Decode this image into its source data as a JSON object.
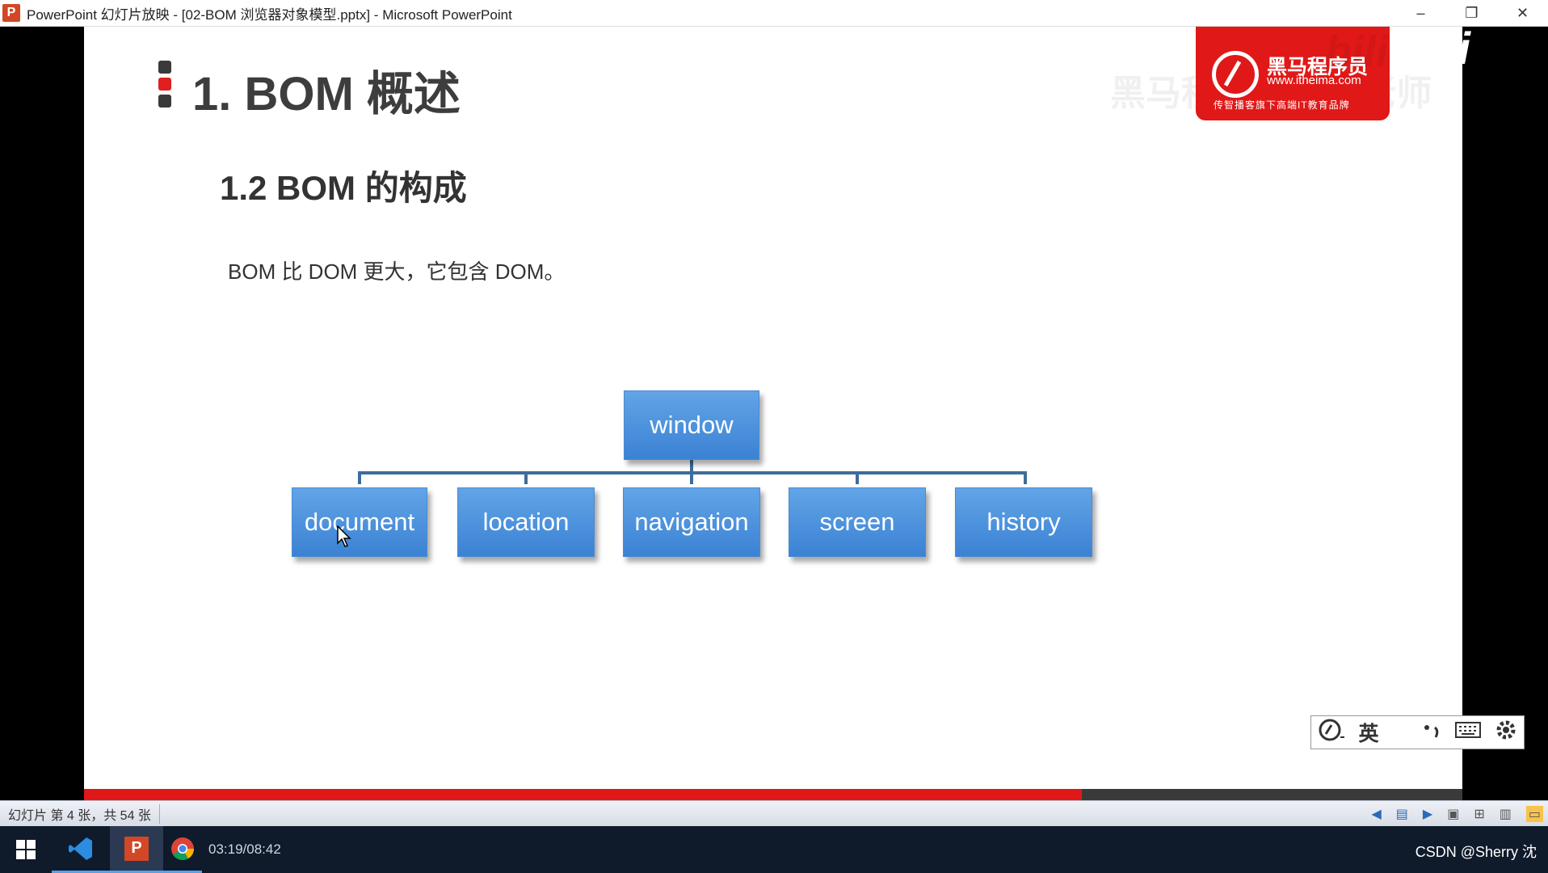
{
  "window": {
    "app_icon": "P",
    "title": "PowerPoint 幻灯片放映 - [02-BOM 浏览器对象模型.pptx] - Microsoft PowerPoint",
    "minimize": "–",
    "restore": "❐",
    "close": "✕"
  },
  "slide": {
    "title": "1. BOM 概述",
    "subtitle": "1.2 BOM 的构成",
    "body": "BOM 比 DOM 更大，它包含 DOM。",
    "diagram": {
      "root": "window",
      "children": [
        "document",
        "location",
        "navigation",
        "screen",
        "history"
      ],
      "box_color": "#4a90dc",
      "connector_color": "#3d6d9c"
    }
  },
  "logo": {
    "brand": "黑马程序员",
    "url": "www.itheima.com",
    "tagline": "传智播客旗下高端IT教育品牌",
    "color": "#e11818"
  },
  "watermark": {
    "text": "黑马程序员pink老师",
    "bili": "bili"
  },
  "slideshow": {
    "progress": 0.724
  },
  "ime": {
    "mode": "英",
    "icons": [
      "ime-logo-icon",
      "moon-icon",
      "punctuation-icon",
      "keyboard-icon",
      "gear-icon"
    ]
  },
  "statusbar": {
    "slide_count": "幻灯片 第 4 张，共 54 张"
  },
  "taskbar": {
    "video_time": "03:19/08:42",
    "credit": "CSDN @Sherry 沈",
    "items": [
      "windows-start-icon",
      "vscode-icon",
      "powerpoint-icon",
      "chrome-icon"
    ]
  }
}
